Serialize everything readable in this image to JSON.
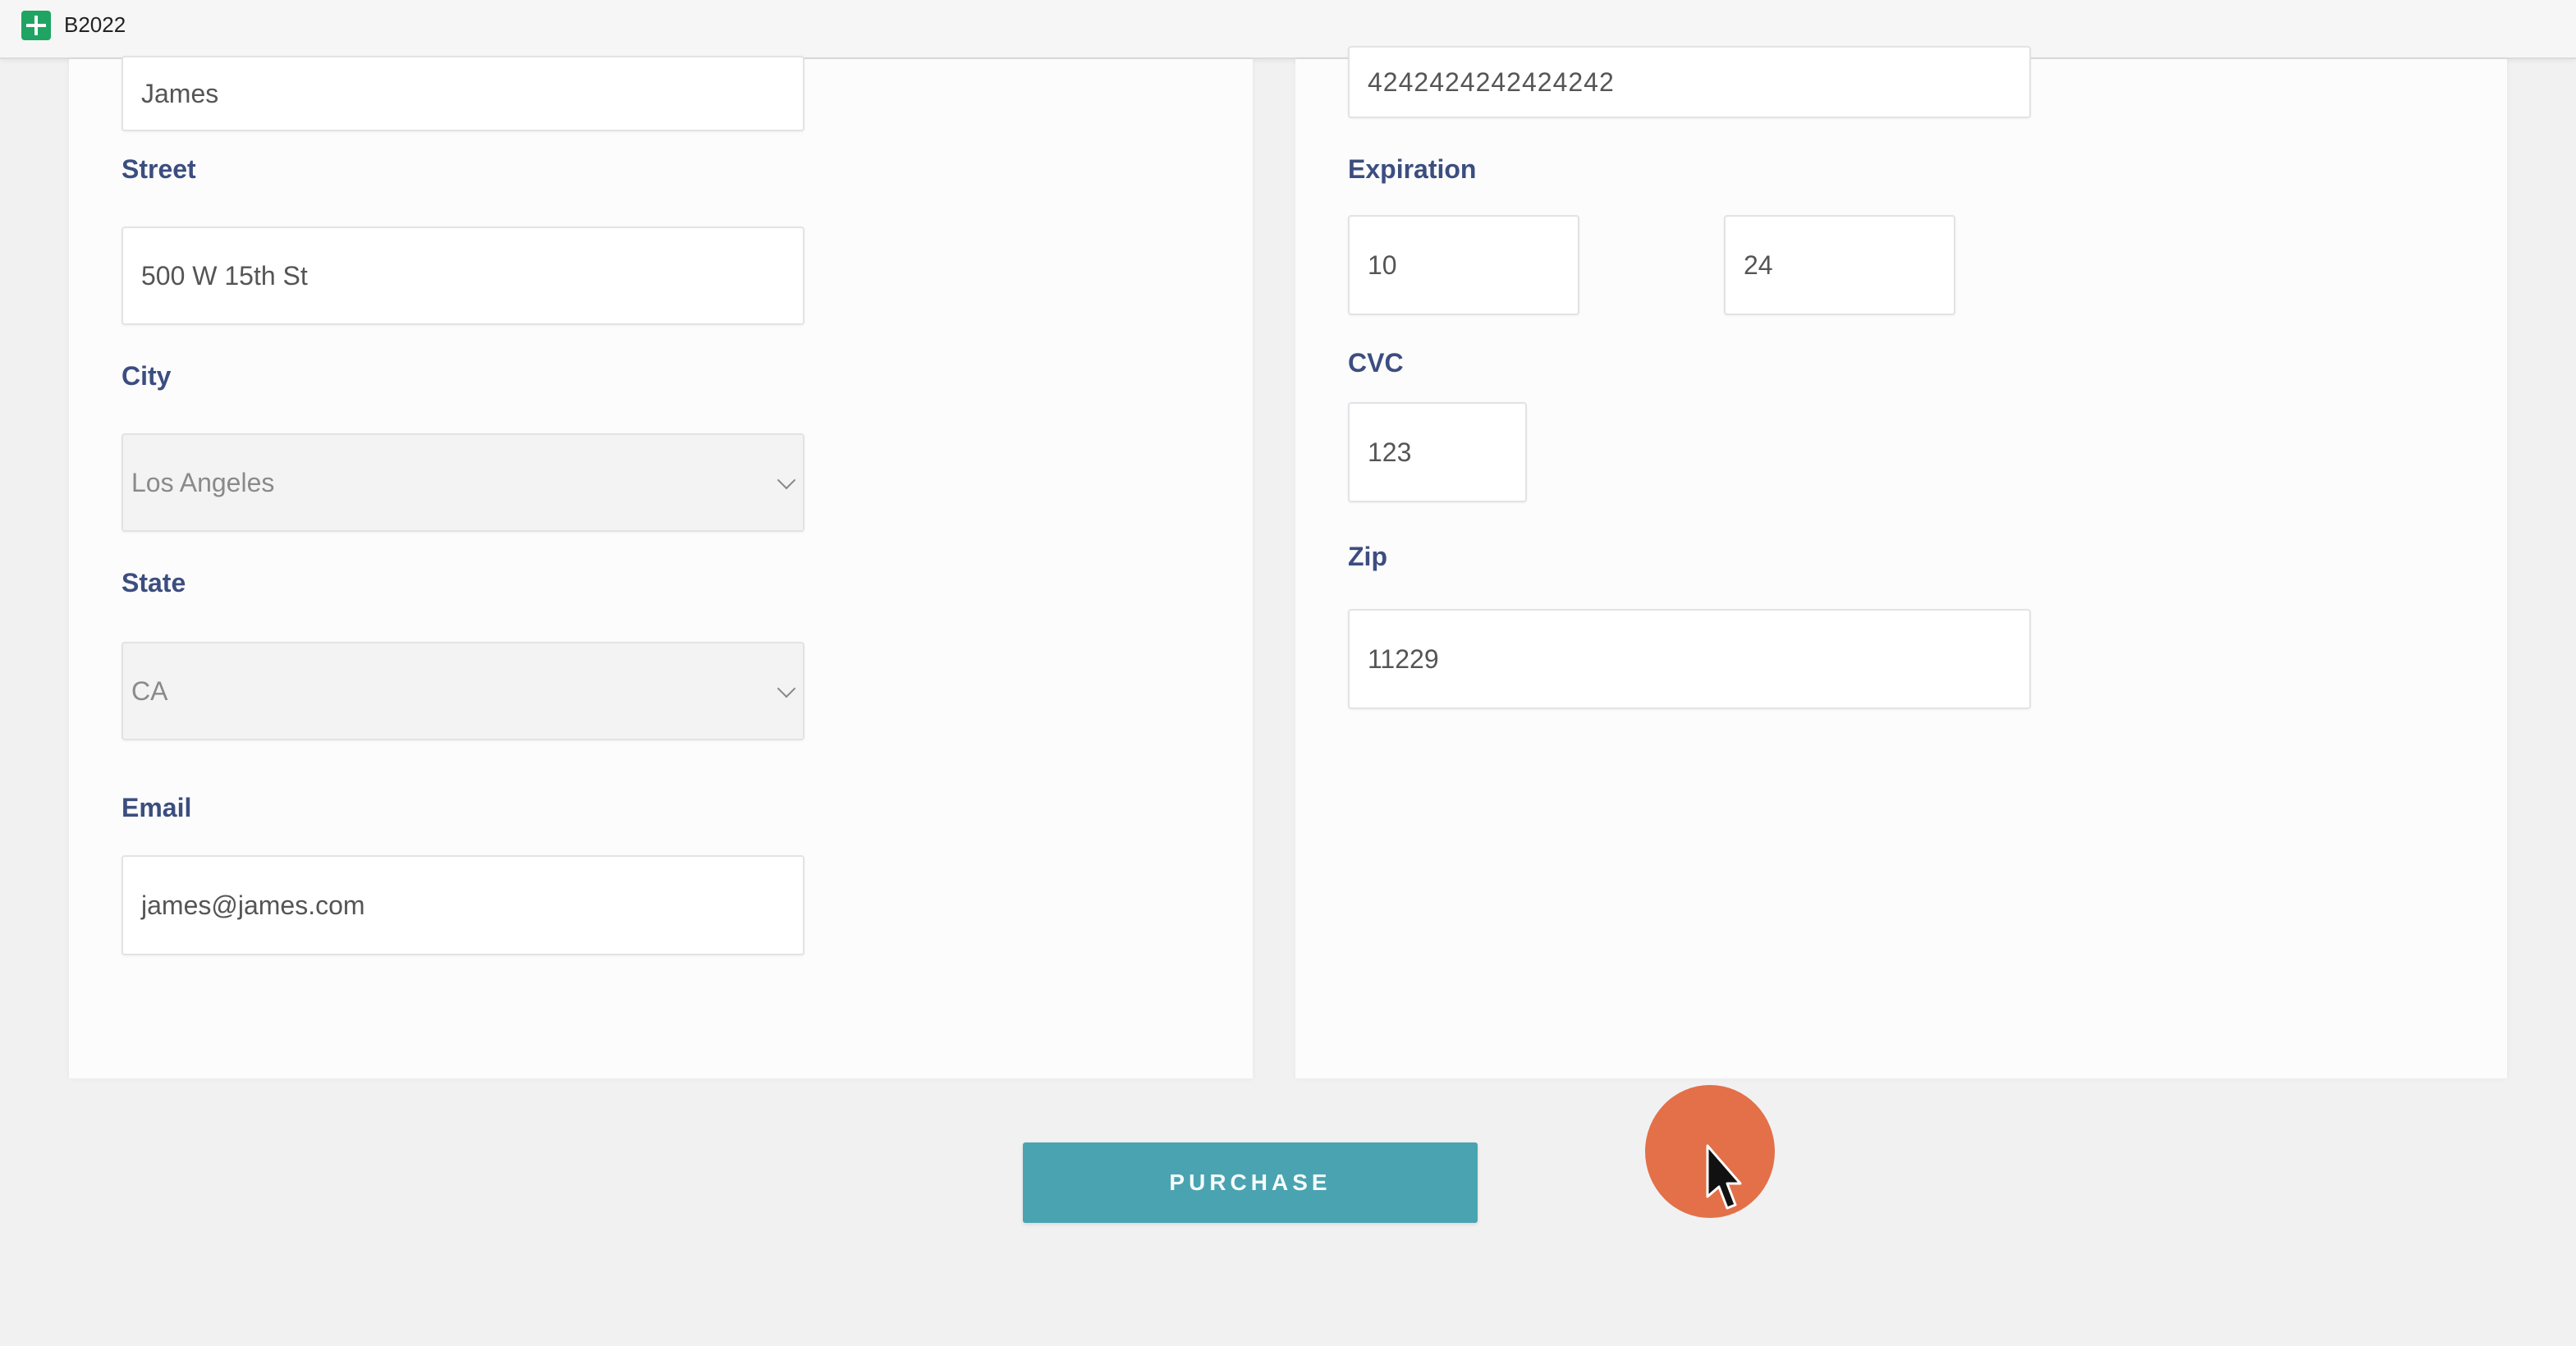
{
  "window": {
    "title": "B2022"
  },
  "billing": {
    "name_value": "James",
    "street_label": "Street",
    "street_value": "500 W 15th St",
    "city_label": "City",
    "city_value": "Los Angeles",
    "state_label": "State",
    "state_value": "CA",
    "email_label": "Email",
    "email_value": "james@james.com"
  },
  "payment": {
    "card_number_value": "4242424242424242",
    "expiration_label": "Expiration",
    "exp_month_value": "10",
    "exp_year_value": "24",
    "cvc_label": "CVC",
    "cvc_value": "123",
    "zip_label": "Zip",
    "zip_value": "11229"
  },
  "actions": {
    "purchase_label": "PURCHASE"
  },
  "colors": {
    "label": "#3c4d80",
    "button": "#4aa3b1",
    "cursor_highlight": "#e2683f",
    "app_icon": "#1fa463"
  },
  "icons": [
    "sheets-app-icon",
    "chevron-down-icon",
    "mouse-pointer-icon"
  ]
}
